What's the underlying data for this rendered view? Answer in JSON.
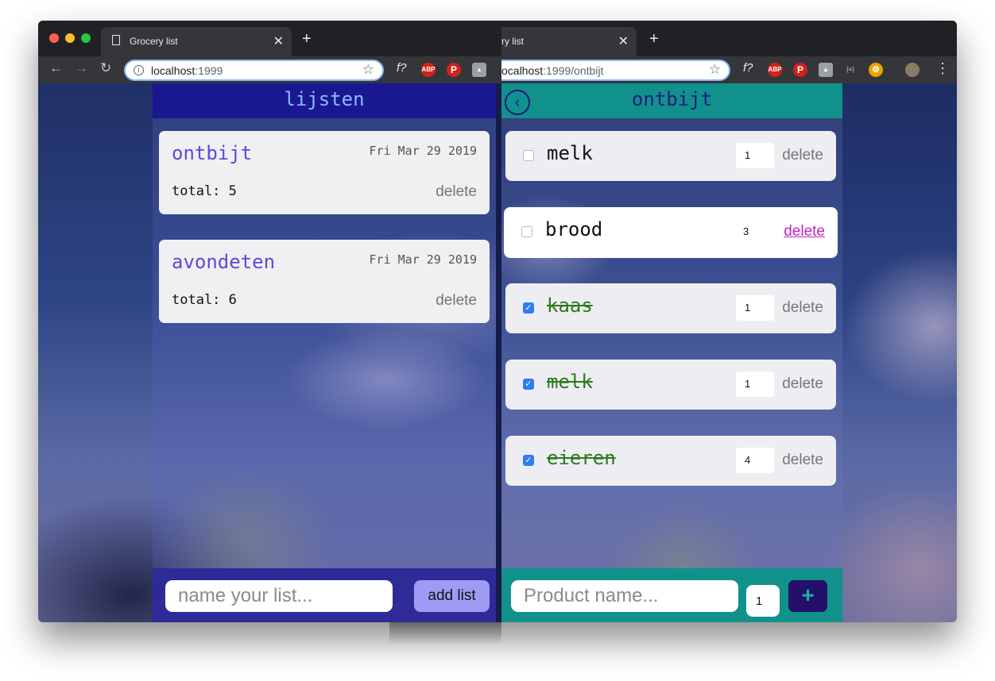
{
  "left_window": {
    "tab_title": "Grocery list",
    "url_host": "localhost",
    "url_rest": ":1999",
    "app": {
      "header": "lijsten",
      "lists": [
        {
          "name": "ontbijt",
          "date": "Fri Mar 29 2019",
          "total": "total: 5",
          "delete": "delete"
        },
        {
          "name": "avondeten",
          "date": "Fri Mar 29 2019",
          "total": "total: 6",
          "delete": "delete"
        }
      ],
      "name_placeholder": "name your list...",
      "add_button": "add list"
    }
  },
  "right_window": {
    "tab_title": "ry list",
    "url_host": "ocalhost",
    "url_rest": ":1999/ontbijt",
    "extension_text": "{≡}",
    "app": {
      "header": "ontbijt",
      "back_icon": "chevron-left-icon",
      "items": [
        {
          "name": "melk",
          "qty": "1",
          "checked": false,
          "delete": "delete"
        },
        {
          "name": "brood",
          "qty": "3",
          "checked": false,
          "delete": "delete"
        },
        {
          "name": "kaas",
          "qty": "1",
          "checked": true,
          "delete": "delete"
        },
        {
          "name": "melk",
          "qty": "1",
          "checked": true,
          "delete": "delete"
        },
        {
          "name": "eieren",
          "qty": "4",
          "checked": true,
          "delete": "delete"
        }
      ],
      "product_placeholder": "Product name...",
      "qty_value": "1",
      "add_button": "+"
    }
  },
  "browser": {
    "new_tab": "+",
    "close": "✕",
    "ext_font": "f?",
    "ext_abp": "ABP"
  },
  "colors": {
    "left_header_bg": "#1a1890",
    "right_header_bg": "#11918b",
    "list_name": "#5a4bd6",
    "checked_text": "#2b7a1f",
    "delete_active": "#c71fc7",
    "add_list_bg": "#9f9bf5",
    "plus_bg": "#24106b"
  }
}
